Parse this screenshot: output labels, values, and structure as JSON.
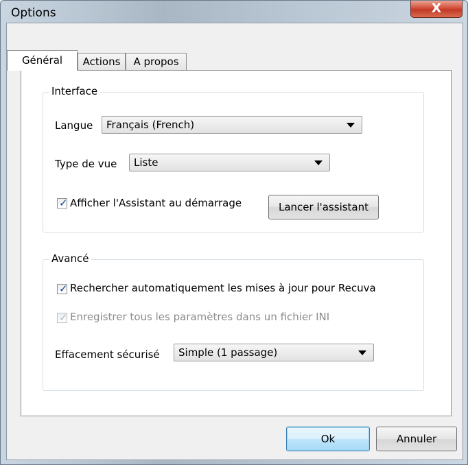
{
  "window": {
    "title": "Options",
    "close_glyph": "X"
  },
  "tabs": [
    {
      "label": "Général",
      "active": true
    },
    {
      "label": "Actions",
      "active": false
    },
    {
      "label": "A propos",
      "active": false
    }
  ],
  "interface": {
    "title": "Interface",
    "language_label": "Langue",
    "language_value": "Français (French)",
    "view_label": "Type de vue",
    "view_value": "Liste",
    "wizard_checkbox_label": "Afficher l'Assistant au démarrage",
    "wizard_checked": true,
    "launch_wizard_button": "Lancer l'assistant"
  },
  "advanced": {
    "title": "Avancé",
    "auto_update_label": "Rechercher automatiquement les mises à jour pour Recuva",
    "auto_update_checked": true,
    "ini_label": "Enregistrer tous les paramètres dans un fichier INI",
    "ini_checked": true,
    "ini_disabled": true,
    "secure_delete_label": "Effacement sécurisé",
    "secure_delete_value": "Simple (1 passage)"
  },
  "footer": {
    "ok_label": "Ok",
    "cancel_label": "Annuler"
  },
  "colors": {
    "accent": "#23418e",
    "close_button": "#c23a26",
    "ok_border": "#3c7fb1"
  }
}
